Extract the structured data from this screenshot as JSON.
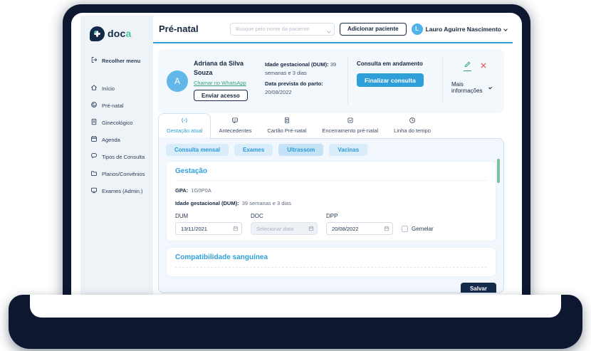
{
  "logo": {
    "text_primary": "doc",
    "text_accent": "a"
  },
  "sidebar": {
    "collapse_label": "Recolher menu",
    "items": [
      {
        "label": "Início",
        "icon": "home-icon"
      },
      {
        "label": "Pré-natal",
        "icon": "prenatal-icon"
      },
      {
        "label": "Ginecológico",
        "icon": "document-icon"
      },
      {
        "label": "Agenda",
        "icon": "calendar-icon"
      },
      {
        "label": "Tipos de Consulta",
        "icon": "chat-icon"
      },
      {
        "label": "Planos/Convênios",
        "icon": "folder-icon"
      },
      {
        "label": "Exames (Admin.)",
        "icon": "monitor-icon"
      }
    ]
  },
  "header": {
    "title": "Pré-natal",
    "search_placeholder": "Busque pelo nome da paciente",
    "add_patient_label": "Adicionar paciente",
    "user": {
      "initial": "L",
      "name": "Lauro Aguirre Nascimento"
    }
  },
  "patient": {
    "initial": "A",
    "name": "Adriana da Silva Souza",
    "whatsapp_link": "Chamar no WhatsApp",
    "send_access_label": "Enviar acesso",
    "gestational_age_label": "Idade gestacional (DUM):",
    "gestational_age_value": "39 semanas e 3 dias",
    "due_date_label": "Data prevista do parto:",
    "due_date_value": "20/08/2022",
    "status": "Consulta em andamento",
    "finish_button_label": "Finalizar consulta",
    "more_info_label": "Mais informações"
  },
  "tabs": [
    {
      "label": "Gestação atual",
      "active": true
    },
    {
      "label": "Antecedentes",
      "active": false
    },
    {
      "label": "Cartão Pré-natal",
      "active": false
    },
    {
      "label": "Encerramento pré-natal",
      "active": false
    },
    {
      "label": "Linha do tempo",
      "active": false
    }
  ],
  "subtabs": [
    "Consulta mensal",
    "Exames",
    "Ultrassom",
    "Vacinas"
  ],
  "gestation": {
    "title": "Gestação",
    "gpa_label": "GPA:",
    "gpa_value": "1G0P0A",
    "iga_label": "Idade gestacional (DUM):",
    "iga_value": "39 semanas e 3 dias",
    "fields": [
      {
        "label": "DUM",
        "value": "13/11/2021"
      },
      {
        "label": "DOC",
        "placeholder": "Selecionar data",
        "disabled": true
      },
      {
        "label": "DPP",
        "value": "20/08/2022"
      }
    ],
    "twin_checkbox_label": "Gemelar"
  },
  "blood": {
    "title": "Compatibilidade sanguínea"
  },
  "footer": {
    "save_label": "Salvar"
  },
  "colors": {
    "accent_blue": "#2e9fd8",
    "navy": "#16273f",
    "laptop_navy": "#0d1830",
    "green": "#35a27c",
    "red": "#e04f4f",
    "pill_bg": "#d9ecfa",
    "sidebar_bg": "#eef3f8",
    "panel_bg": "#f1f7fc",
    "scroll_thumb_green": "#7cc09c",
    "logo_teal": "#4ec3a5"
  }
}
